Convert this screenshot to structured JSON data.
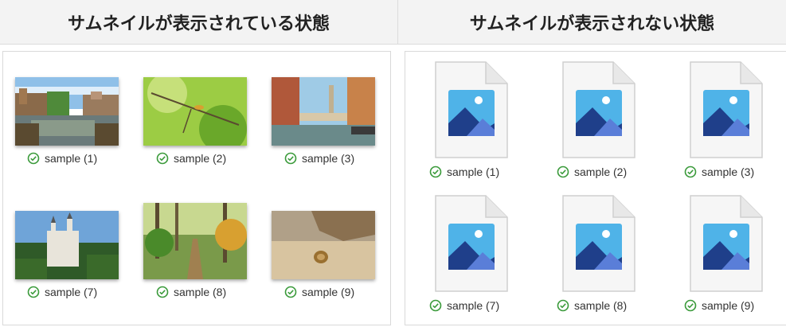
{
  "headers": {
    "left": "サムネイルが表示されている状態",
    "right": "サムネイルが表示されない状態"
  },
  "left_panel": {
    "items": [
      {
        "label": "sample (1)",
        "scene": "canal"
      },
      {
        "label": "sample (2)",
        "scene": "leaves"
      },
      {
        "label": "sample (3)",
        "scene": "venice"
      },
      {
        "label": "sample (7)",
        "scene": "castle"
      },
      {
        "label": "sample (8)",
        "scene": "forest"
      },
      {
        "label": "sample (9)",
        "scene": "snail"
      }
    ]
  },
  "right_panel": {
    "items": [
      {
        "label": "sample (1)"
      },
      {
        "label": "sample (2)"
      },
      {
        "label": "sample (3)"
      },
      {
        "label": "sample (7)"
      },
      {
        "label": "sample (8)"
      },
      {
        "label": "sample (9)"
      }
    ]
  },
  "colors": {
    "sync_check": "#3a9a3a",
    "icon_sky": "#4fb3e8",
    "icon_mountain_dark": "#1f3f8a",
    "icon_mountain_light": "#5a7ed8"
  }
}
